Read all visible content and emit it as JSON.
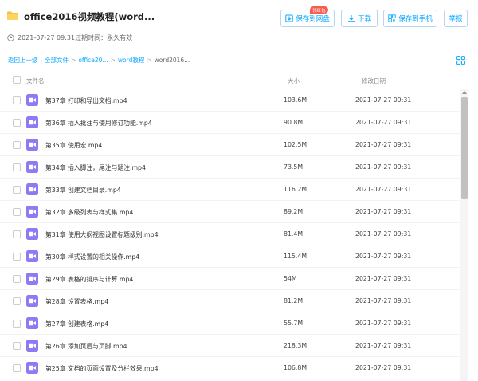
{
  "header": {
    "title": "office2016视频教程(word...",
    "meta": "2021-07-27 09:31过期时间：永久有效",
    "buttons": {
      "save_cloud": "保存到网盘",
      "download": "下载",
      "save_phone": "保存到手机",
      "report": "举报"
    },
    "badge": "领红包"
  },
  "breadcrumb": {
    "back": "返回上一级",
    "all_files": "全部文件",
    "level1": "office20...",
    "level2": "word教程",
    "current": "word2016..."
  },
  "columns": {
    "name": "文件名",
    "size": "大小",
    "date": "修改日期"
  },
  "files": [
    {
      "name": "第37章 打印和导出文档.mp4",
      "size": "103.6M",
      "date": "2021-07-27 09:31"
    },
    {
      "name": "第36章 插入批注与使用修订功能.mp4",
      "size": "90.8M",
      "date": "2021-07-27 09:31"
    },
    {
      "name": "第35章 使用宏.mp4",
      "size": "102.5M",
      "date": "2021-07-27 09:31"
    },
    {
      "name": "第34章 插入脚注，尾注与题注.mp4",
      "size": "73.5M",
      "date": "2021-07-27 09:31"
    },
    {
      "name": "第33章 创建文档目录.mp4",
      "size": "116.2M",
      "date": "2021-07-27 09:31"
    },
    {
      "name": "第32章 多级列表与样式集.mp4",
      "size": "89.2M",
      "date": "2021-07-27 09:31"
    },
    {
      "name": "第31章 使用大纲视图设置标题级别.mp4",
      "size": "81.4M",
      "date": "2021-07-27 09:31"
    },
    {
      "name": "第30章 样式设置的相关操作.mp4",
      "size": "115.4M",
      "date": "2021-07-27 09:31"
    },
    {
      "name": "第29章 表格的排序与计算.mp4",
      "size": "54M",
      "date": "2021-07-27 09:31"
    },
    {
      "name": "第28章 设置表格.mp4",
      "size": "81.2M",
      "date": "2021-07-27 09:31"
    },
    {
      "name": "第27章 创建表格.mp4",
      "size": "55.7M",
      "date": "2021-07-27 09:31"
    },
    {
      "name": "第26章 添加页眉与页脚.mp4",
      "size": "218.3M",
      "date": "2021-07-27 09:31"
    },
    {
      "name": "第25章 文档的页面设置及分栏效果.mp4",
      "size": "106.8M",
      "date": "2021-07-27 09:31"
    }
  ],
  "colors": {
    "accent": "#06a7ff",
    "video_icon": "#8c7bf2",
    "folder": "#f7c244",
    "badge": "#fa5b4c"
  },
  "icons": [
    "folder-icon",
    "clock-icon",
    "save-cloud-icon",
    "download-icon",
    "phone-icon",
    "grid-view-icon",
    "video-file-icon"
  ]
}
